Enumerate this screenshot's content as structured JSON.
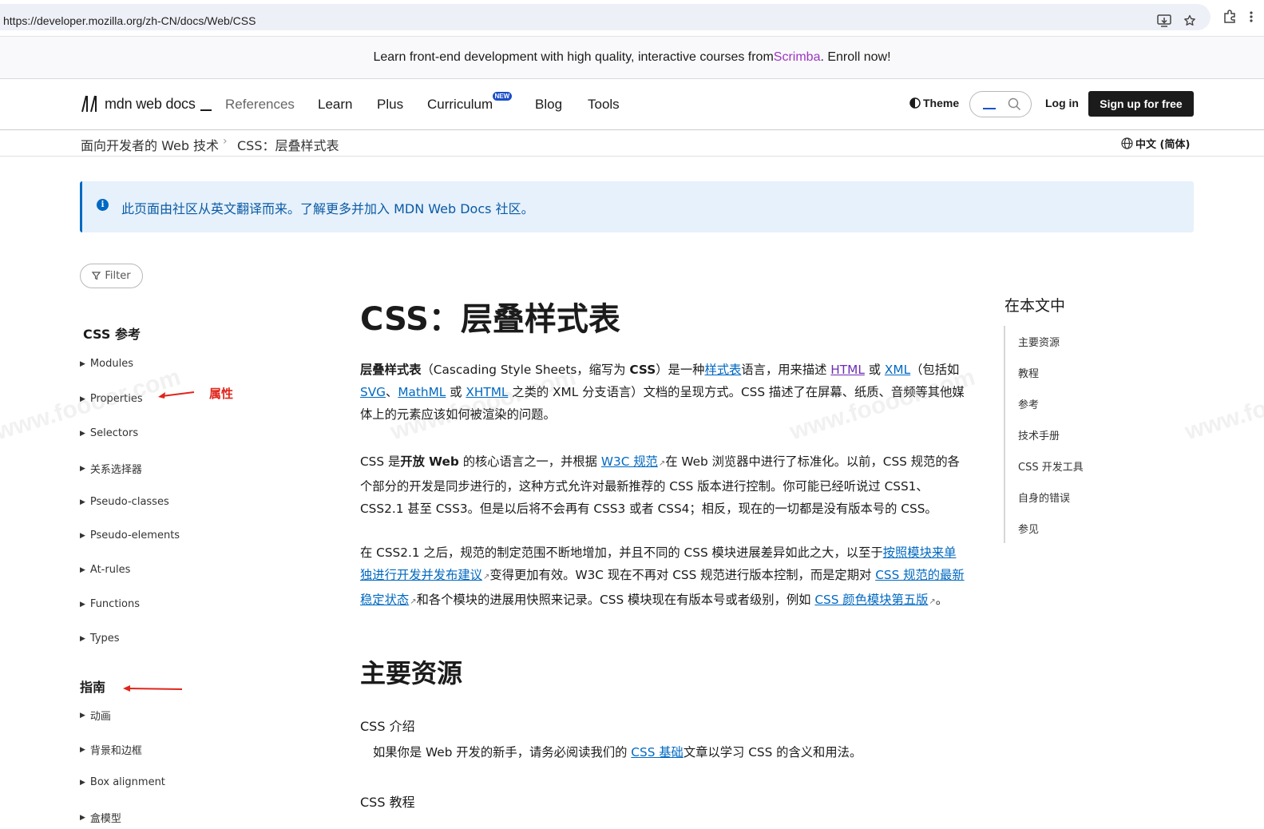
{
  "browser": {
    "url": "https://developer.mozilla.org/zh-CN/docs/Web/CSS"
  },
  "promo": {
    "text_before": "Learn front-end development with high quality, interactive courses from ",
    "brand": "Scrimba",
    "text_after": ". Enroll now!"
  },
  "header": {
    "logo_text": "mdn web docs",
    "nav": [
      "References",
      "Learn",
      "Plus",
      "Curriculum",
      "Blog",
      "Tools"
    ],
    "new_badge": "NEW",
    "theme": "Theme",
    "login": "Log in",
    "signup": "Sign up for free"
  },
  "breadcrumb": {
    "items": [
      "面向开发者的 Web 技术",
      "CSS：层叠样式表"
    ],
    "language": "中文 (简体)"
  },
  "notice": {
    "text": "此页面由社区从英文翻译而来。了解更多并加入 MDN Web Docs 社区。"
  },
  "sidebar": {
    "filter": "Filter",
    "section1": "CSS 参考",
    "items1": [
      "Modules",
      "Properties",
      "Selectors",
      "关系选择器",
      "Pseudo-classes",
      "Pseudo-elements",
      "At-rules",
      "Functions",
      "Types"
    ],
    "section2": "指南",
    "items2": [
      "动画",
      "背景和边框",
      "Box alignment",
      "盒模型"
    ]
  },
  "annotations": {
    "properties_label": "属性"
  },
  "article": {
    "title": "CSS：层叠样式表",
    "p1": {
      "b1": "层叠样式表",
      "t1": "（Cascading Style Sheets，缩写为 ",
      "b2": "CSS",
      "t2": "）是一种",
      "l1": "样式表",
      "t3": "语言，用来描述 ",
      "l2": "HTML",
      "t4": " 或 ",
      "l3": "XML",
      "t5": "（包括如 ",
      "l4": "SVG",
      "t6": "、",
      "l5": "MathML",
      "t7": " 或 ",
      "l6": "XHTML",
      "t8": " 之类的 XML 分支语言）文档的呈现方式。CSS 描述了在屏幕、纸质、音频等其他媒体上的元素应该如何被渲染的问题。"
    },
    "p2": {
      "t1": "CSS 是",
      "b1": "开放 Web",
      "t2": " 的核心语言之一，并根据 ",
      "l1": "W3C 规范",
      "t3": "在 Web 浏览器中进行了标准化。以前，CSS 规范的各个部分的开发是同步进行的，这种方式允许对最新推荐的 CSS 版本进行控制。你可能已经听说过 CSS1、CSS2.1 甚至 CSS3。但是以后将不会再有 CSS3 或者 CSS4；相反，现在的一切都是没有版本号的 CSS。"
    },
    "p3": {
      "t1": "在 CSS2.1 之后，规范的制定范围不断地增加，并且不同的 CSS 模块进展差异如此之大，以至于",
      "l1": "按照模块来单独进行开发并发布建议",
      "t2": "变得更加有效。W3C 现在不再对 CSS 规范进行版本控制，而是定期对 ",
      "l2": "CSS 规范的最新稳定状态",
      "t3": "和各个模块的进展用快照来记录。CSS 模块现在有版本号或者级别，例如 ",
      "l3": "CSS 颜色模块第五版",
      "t4": "。"
    },
    "h2": "主要资源",
    "dt1": "CSS 介绍",
    "dd1": {
      "t1": "如果你是 Web 开发的新手，请务必阅读我们的 ",
      "l1": "CSS 基础",
      "t2": "文章以学习 CSS 的含义和用法。"
    },
    "dt2": "CSS 教程"
  },
  "toc": {
    "title": "在本文中",
    "items": [
      "主要资源",
      "教程",
      "参考",
      "技术手册",
      "CSS 开发工具",
      "自身的错误",
      "参见"
    ]
  },
  "colors": {
    "link": "#0069c2",
    "visited": "#6e2cb3",
    "annotation": "#e0251b",
    "notice_bg": "#e6f1fb"
  }
}
